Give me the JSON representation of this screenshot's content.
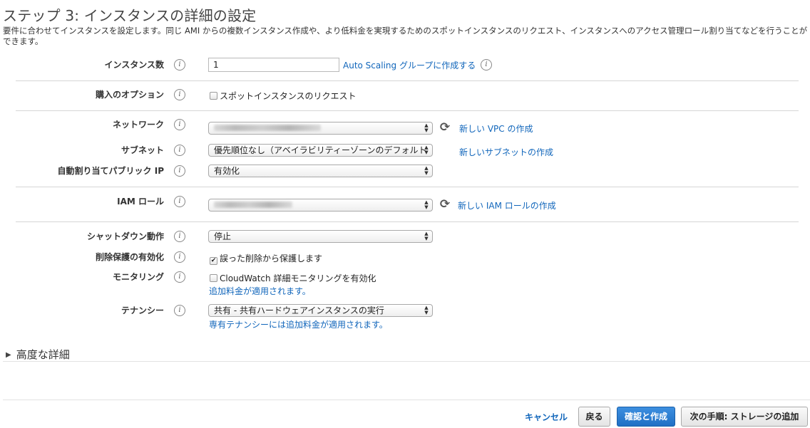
{
  "page": {
    "title": "ステップ 3: インスタンスの詳細の設定",
    "description": "要件に合わせてインスタンスを設定します。同じ AMI からの複数インスタンス作成や、より低料金を実現するためのスポットインスタンスのリクエスト、インスタンスへのアクセス管理ロール割り当てなどを行うことができます。"
  },
  "fields": {
    "instance_count": {
      "label": "インスタンス数",
      "value": "1",
      "link": "Auto Scaling グループに作成する"
    },
    "purchase_option": {
      "label": "購入のオプション",
      "checkbox_label": "スポットインスタンスのリクエスト",
      "checked": false
    },
    "network": {
      "label": "ネットワーク",
      "link": "新しい VPC の作成"
    },
    "subnet": {
      "label": "サブネット",
      "value": "優先順位なし（アベイラビリティーゾーンのデフォルト",
      "link": "新しいサブネットの作成"
    },
    "auto_assign_ip": {
      "label": "自動割り当てパブリック IP",
      "value": "有効化"
    },
    "iam_role": {
      "label": "IAM ロール",
      "link": "新しい IAM ロールの作成"
    },
    "shutdown": {
      "label": "シャットダウン動作",
      "value": "停止"
    },
    "termination_protection": {
      "label": "削除保護の有効化",
      "checkbox_label": "誤った削除から保護します",
      "checked": true
    },
    "monitoring": {
      "label": "モニタリング",
      "checkbox_label": "CloudWatch 詳細モニタリングを有効化",
      "checked": false,
      "note": "追加料金が適用されます。"
    },
    "tenancy": {
      "label": "テナンシー",
      "value": "共有 - 共有ハードウェアインスタンスの実行",
      "note": "専有テナンシーには追加料金が適用されます。"
    }
  },
  "advanced": {
    "label": "高度な詳細"
  },
  "footer": {
    "cancel": "キャンセル",
    "back": "戻る",
    "review": "確認と作成",
    "next": "次の手順: ストレージの追加"
  },
  "colors": {
    "link": "#1166bb",
    "primary_button": "#2a7cd2"
  },
  "icons": {
    "info": "info-icon",
    "refresh": "refresh-icon",
    "expand": "triangle-right-icon"
  }
}
